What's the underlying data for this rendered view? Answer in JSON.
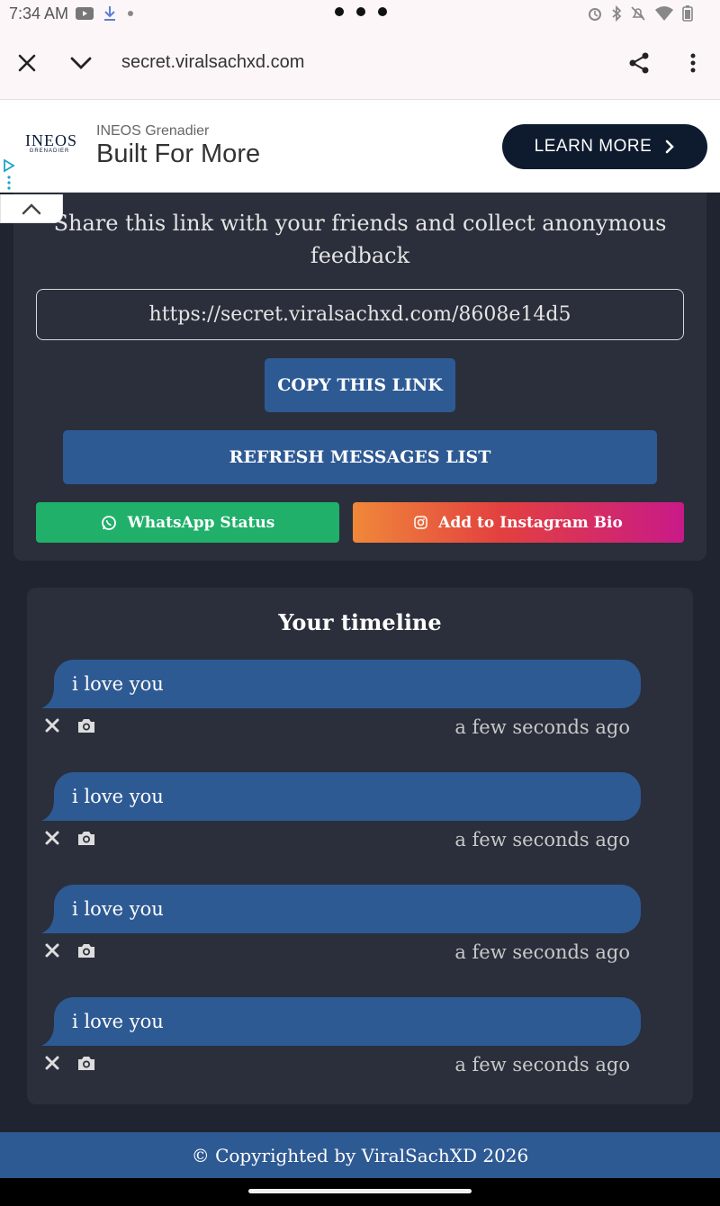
{
  "status_bar": {
    "time": "7:34 AM",
    "left_icons": [
      "youtube-icon",
      "download-icon",
      "dot-icon"
    ],
    "right_icons": [
      "alarm-icon",
      "bluetooth-icon",
      "mute-icon",
      "wifi-icon",
      "battery-icon"
    ]
  },
  "browser": {
    "url": "secret.viralsachxd.com",
    "icons": [
      "close-icon",
      "chevron-down-icon",
      "share-icon",
      "more-vert-icon"
    ]
  },
  "ad": {
    "logo_main": "INEOS",
    "logo_sub": "GRENADIER",
    "brand": "INEOS Grenadier",
    "headline": "Built For More",
    "cta": "LEARN MORE",
    "cta_color": "#0e1a2e"
  },
  "share": {
    "heading": "Share this link with your friends and collect anonymous feedback",
    "link": "https://secret.viralsachxd.com/8608e14d5",
    "copy_button": "COPY THIS LINK",
    "refresh_button": "REFRESH MESSAGES LIST",
    "whatsapp_button": "WhatsApp Status",
    "instagram_button": "Add to Instagram Bio"
  },
  "timeline": {
    "title": "Your timeline",
    "messages": [
      {
        "text": "i love you",
        "time": "a few seconds ago"
      },
      {
        "text": "i love you",
        "time": "a few seconds ago"
      },
      {
        "text": "i love you",
        "time": "a few seconds ago"
      },
      {
        "text": "i love you",
        "time": "a few seconds ago"
      }
    ]
  },
  "footer": {
    "text": "© Copyrighted by ViralSachXD 2026"
  },
  "colors": {
    "background": "#1f2430",
    "card": "#2a2f3b",
    "primary": "#2e5a94",
    "whatsapp": "#20b06a"
  }
}
